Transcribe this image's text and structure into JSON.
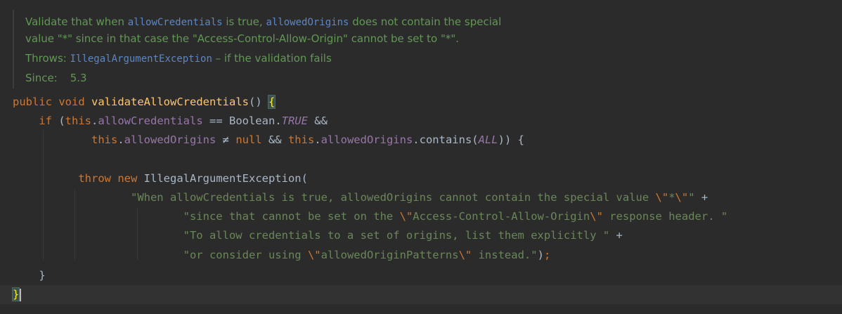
{
  "javadoc": {
    "line1": {
      "t1": "Validate that when ",
      "c1": "allowCredentials",
      "t2": " is true, ",
      "c2": "allowedOrigins",
      "t3": " does not contain the special"
    },
    "line2": "value \"*\" since in that case the \"Access-Control-Allow-Origin\" cannot be set to \"*\".",
    "throws": {
      "label": "Throws: ",
      "exception": "IllegalArgumentException",
      "desc": " – if the validation fails"
    },
    "since": {
      "label": "Since:",
      "value": "5.3"
    }
  },
  "code": {
    "l1": {
      "public": "public",
      "void": "void",
      "method": "validateAllowCredentials",
      "parens": "() ",
      "brace": "{"
    },
    "l2": {
      "if": "if",
      "open": " (",
      "this": "this",
      "dot": ".",
      "field": "allowCredentials",
      "op": " == Boolean.",
      "const": "TRUE",
      "and": " &&"
    },
    "l3": {
      "this1": "this",
      "dot1": ".",
      "field1": "allowedOrigins",
      "op": " ≠ ",
      "null": "null",
      "and": " && ",
      "this2": "this",
      "dot2": ".",
      "field2": "allowedOrigins",
      "call": ".contains(",
      "const": "ALL",
      "close": ")) {"
    },
    "l4": {
      "throw": "throw",
      "new": "new",
      "cls": " IllegalArgumentException("
    },
    "l5": {
      "s1": "\"When allowCredentials is true, allowedOrigins cannot contain the special value ",
      "e1": "\\\"",
      "s2": "*",
      "e2": "\\\"",
      "s3": "\"",
      "plus": " +"
    },
    "l6": {
      "s1": "\"since that cannot be set on the ",
      "e1": "\\\"",
      "s2": "Access-Control-Allow-Origin",
      "e2": "\\\"",
      "s3": " response header. \""
    },
    "l7": {
      "s1": "\"To allow credentials to a set of origins, list them explicitly \"",
      "plus": " +"
    },
    "l8": {
      "s1": "\"or consider using ",
      "e1": "\\\"",
      "s2": "allowedOriginPatterns",
      "e2": "\\\"",
      "s3": " instead.\"",
      "close": ")",
      "semi": ";"
    },
    "l9": {
      "brace": "}"
    },
    "l10": {
      "brace": "}"
    }
  }
}
